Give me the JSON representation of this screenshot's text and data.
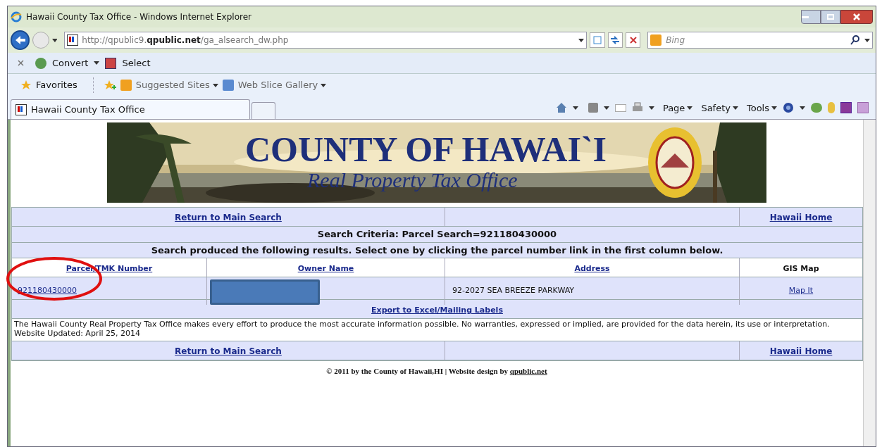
{
  "window": {
    "title": "Hawaii County Tax Office - Windows Internet Explorer"
  },
  "address_bar": {
    "url_prefix": "http://qpublic9.",
    "url_domain": "qpublic.net",
    "url_path": "/ga_alsearch_dw.php"
  },
  "search": {
    "placeholder": "Bing"
  },
  "addon_bar": {
    "buttons": [
      "Convert",
      "Select"
    ]
  },
  "favorites_bar": {
    "items": [
      {
        "label": "Favorites",
        "kind": "favorites"
      },
      {
        "label": "Suggested Sites",
        "kind": "menu"
      },
      {
        "label": "Web Slice Gallery",
        "kind": "menu"
      }
    ]
  },
  "tabs": [
    {
      "label": "Hawaii County Tax Office",
      "selected": true
    }
  ],
  "command_bar": {
    "menus": [
      "Page",
      "Safety",
      "Tools"
    ]
  },
  "banner": {
    "title": "COUNTY OF HAWAI`I",
    "subtitle": "Real Property Tax Office"
  },
  "nav_links": {
    "left": "Return to Main Search",
    "right": "Hawaii Home"
  },
  "search_criteria": "Search Criteria: Parcel Search=921180430000",
  "instructions": "Search produced the following results. Select one by clicking the parcel number link in the first column below.",
  "table": {
    "columns": [
      {
        "label": "Parcel/TMK Number",
        "link": true
      },
      {
        "label": "Owner Name",
        "link": true
      },
      {
        "label": "Address",
        "link": true
      },
      {
        "label": "GIS Map",
        "link": false
      }
    ],
    "rows": [
      {
        "parcel": "921180430000",
        "owner_redacted": true,
        "address": "92-2027 SEA BREEZE PARKWAY",
        "map": "Map It"
      }
    ]
  },
  "export_link": "Export to Excel/Mailing Labels",
  "disclaimer": "The Hawaii County Real Property Tax Office makes every effort to produce the most accurate information possible. No warranties, expressed or implied, are provided for the data herein, its use or interpretation. Website Updated: April 25, 2014",
  "footer_nav": {
    "left": "Return to Main Search",
    "right": "Hawaii Home"
  },
  "copyright": {
    "text": "© 2011 by the County of Hawaii,HI | Website design by ",
    "link": "qpublic.net"
  }
}
